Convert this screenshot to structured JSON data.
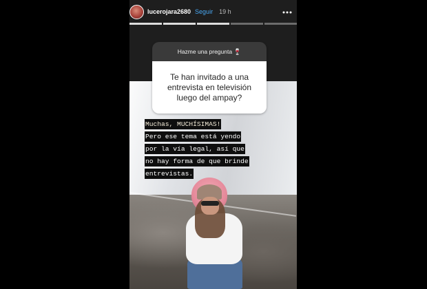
{
  "story": {
    "username": "lucerojara2680",
    "follow_label": "Seguir",
    "time_ago": "19 h",
    "more_icon": "more-dots-icon",
    "progress": {
      "segments": 5,
      "completed": 2,
      "active_index": 2
    }
  },
  "question": {
    "header": "Hazme una pregunta",
    "header_emoji": "🍷",
    "text": "Te han invitado a una entrevista en televisión luego del ampay?"
  },
  "answer": {
    "lines": [
      "Muchas, MUCHÍSIMAS!",
      "Pero ese tema está yendo",
      "por la vía legal, así que",
      "no hay forma de que brinde",
      "entrevistas."
    ]
  },
  "colors": {
    "background": "#000000",
    "accent_link": "#49a8f3",
    "question_header_bg": "#3a3a3a",
    "question_body_bg": "#ffffff",
    "answer_highlight": "#0e0e0e"
  }
}
